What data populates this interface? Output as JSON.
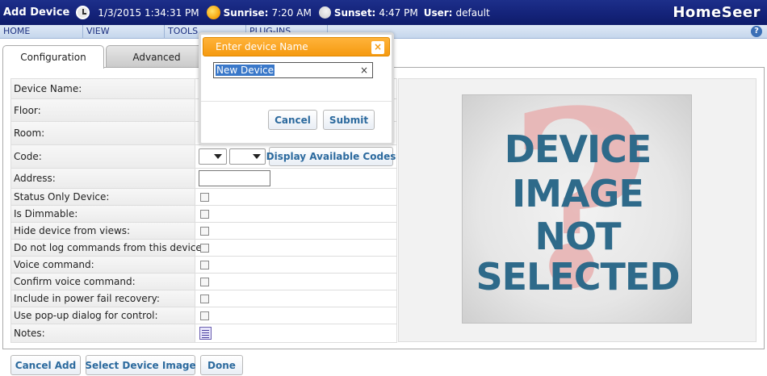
{
  "header": {
    "title": "Add Device",
    "datetime": "1/3/2015 1:34:31 PM",
    "sunrise_label": "Sunrise:",
    "sunrise": "7:20 AM",
    "sunset_label": "Sunset:",
    "sunset": "4:47 PM",
    "user_label": "User:",
    "user": "default",
    "logo": "HomeSeer",
    "icons": [
      "clock-icon",
      "sun-icon",
      "moon-icon"
    ]
  },
  "menu": {
    "items": [
      "HOME",
      "VIEW",
      "TOOLS",
      "PLUG-INS"
    ],
    "help_icon": "?"
  },
  "tabs": [
    "Configuration",
    "Advanced"
  ],
  "form": {
    "device_name": "Device Name:",
    "floor": "Floor:",
    "room": "Room:",
    "code": "Code:",
    "display_codes_button": "Display Available Codes",
    "address": "Address:",
    "status_only": "Status Only Device:",
    "is_dimmable": "Is Dimmable:",
    "hide_device": "Hide device from views:",
    "no_log": "Do not log commands from this device:",
    "voice_command": "Voice command:",
    "confirm_voice": "Confirm voice command:",
    "power_fail": "Include in power fail recovery:",
    "popup_dialog": "Use pop-up dialog for control:",
    "notes": "Notes:"
  },
  "image_panel": {
    "lines": [
      "DEVICE",
      "IMAGE",
      "NOT",
      "SELECTED"
    ],
    "symbol": "?"
  },
  "buttons": {
    "cancel_add": "Cancel Add",
    "select_image": "Select Device Image",
    "done": "Done"
  },
  "dialog": {
    "title": "Enter device Name",
    "close": "×",
    "input_value": "New Device",
    "clear": "×",
    "cancel": "Cancel",
    "submit": "Submit"
  },
  "colors": {
    "header_bg": "#14237a",
    "menu_bg": "#c5d6ec",
    "dialog_title_bg": "#f59a10",
    "button_text": "#2c6a9e",
    "image_text": "#2e6a8a"
  }
}
